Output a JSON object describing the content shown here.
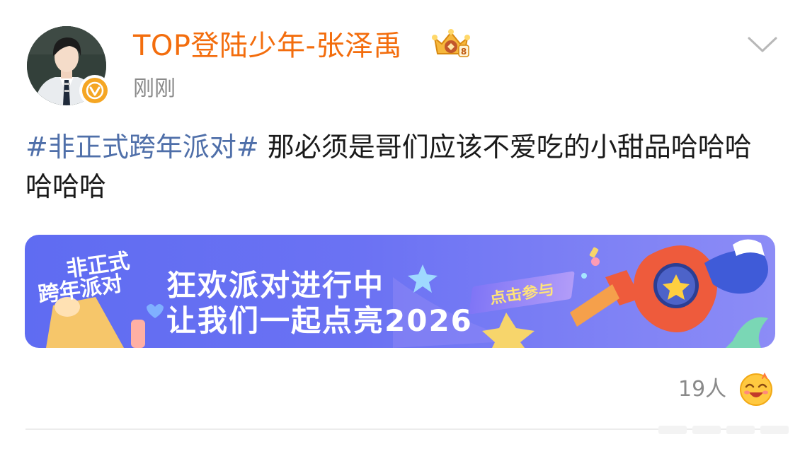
{
  "post": {
    "username": "TOP登陆少年-张泽禹",
    "timestamp": "刚刚",
    "text": {
      "hashtag": "#非正式跨年派对#",
      "body": " 那必须是哥们应该不爱吃的小甜品哈哈哈哈哈哈"
    }
  },
  "banner": {
    "logo_line1": "非正式",
    "logo_line2": "跨年派对",
    "headline": "狂欢派对进行中",
    "subline": "让我们一起点亮2026",
    "cta": "点击参与"
  },
  "reactions": {
    "count": "19人"
  },
  "colors": {
    "username": "#f36d0d",
    "hashtag": "#4f6fa9",
    "timestamp": "#8a8a8a",
    "banner_bg": "#6b72f3",
    "verified": "#f5a623"
  },
  "icons": [
    "avatar",
    "verified-badge-icon",
    "vip-crown-icon",
    "chevron-down-icon",
    "reaction-emoji-icon"
  ]
}
